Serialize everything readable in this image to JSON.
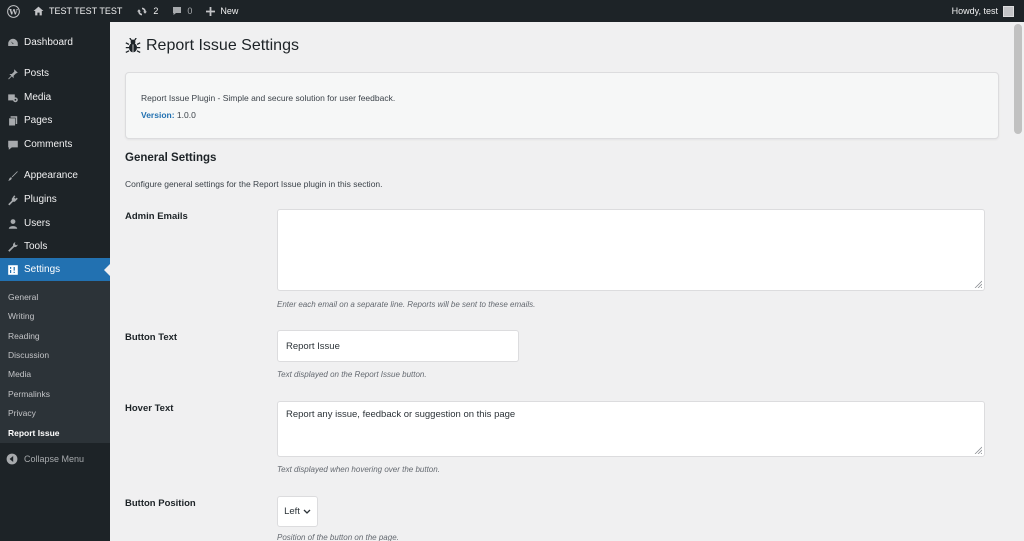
{
  "adminbar": {
    "site_name": "TEST TEST TEST",
    "updates_count": "2",
    "comments_count": "0",
    "new_label": "New",
    "howdy": "Howdy, test"
  },
  "sidebar": {
    "items": [
      {
        "label": "Dashboard",
        "icon": "dashboard-icon"
      },
      {
        "label": "Posts",
        "icon": "pin-icon"
      },
      {
        "label": "Media",
        "icon": "media-icon"
      },
      {
        "label": "Pages",
        "icon": "pages-icon"
      },
      {
        "label": "Comments",
        "icon": "comment-icon"
      },
      {
        "label": "Appearance",
        "icon": "brush-icon"
      },
      {
        "label": "Plugins",
        "icon": "plug-icon"
      },
      {
        "label": "Users",
        "icon": "user-icon"
      },
      {
        "label": "Tools",
        "icon": "wrench-icon"
      },
      {
        "label": "Settings",
        "icon": "settings-icon"
      }
    ],
    "submenu": [
      "General",
      "Writing",
      "Reading",
      "Discussion",
      "Media",
      "Permalinks",
      "Privacy",
      "Report Issue"
    ],
    "collapse_label": "Collapse Menu"
  },
  "page": {
    "title": "Report Issue Settings",
    "info_description": "Report Issue Plugin - Simple and secure solution for user feedback.",
    "version_label": "Version:",
    "version_value": "1.0.0",
    "section_title": "General Settings",
    "section_description": "Configure general settings for the Report Issue plugin in this section.",
    "fields": {
      "admin_emails": {
        "label": "Admin Emails",
        "value": "",
        "hint": "Enter each email on a separate line. Reports will be sent to these emails."
      },
      "button_text": {
        "label": "Button Text",
        "value": "Report Issue",
        "hint": "Text displayed on the Report Issue button."
      },
      "hover_text": {
        "label": "Hover Text",
        "value": "Report any issue, feedback or suggestion on this page",
        "hint": "Text displayed when hovering over the button."
      },
      "button_position": {
        "label": "Button Position",
        "value": "Left",
        "hint": "Position of the button on the page."
      }
    }
  },
  "colors": {
    "admin_bar": "#1d2327",
    "menu_active": "#2271b1",
    "submenu_bg": "#2c3338",
    "content_bg": "#f0f0f1",
    "link": "#2271b1"
  }
}
